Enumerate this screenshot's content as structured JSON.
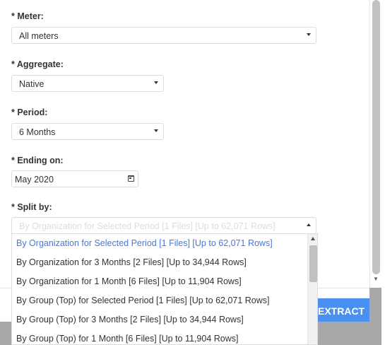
{
  "form": {
    "meter": {
      "label": "* Meter:",
      "value": "All meters"
    },
    "aggregate": {
      "label": "* Aggregate:",
      "value": "Native"
    },
    "period": {
      "label": "* Period:",
      "value": "6 Months"
    },
    "ending_on": {
      "label": "* Ending on:",
      "value": "May 2020"
    },
    "split_by": {
      "label": "* Split by:",
      "value": "By Organization for Selected Period [1 Files] [Up to 62,071 Rows]",
      "options": [
        {
          "label": "By Organization for Selected Period [1 Files] [Up to 62,071 Rows]",
          "selected": true
        },
        {
          "label": "By Organization for 3 Months [2 Files] [Up to 34,944 Rows]",
          "selected": false
        },
        {
          "label": "By Organization for 1 Month [6 Files] [Up to 11,904 Rows]",
          "selected": false
        },
        {
          "label": "By Group (Top) for Selected Period [1 Files] [Up to 62,071 Rows]",
          "selected": false
        },
        {
          "label": "By Group (Top) for 3 Months [2 Files] [Up to 34,944 Rows]",
          "selected": false
        },
        {
          "label": "By Group (Top) for 1 Month [6 Files] [Up to 11,904 Rows]",
          "selected": false
        }
      ]
    }
  },
  "footer": {
    "extract_label": "EXTRACT"
  },
  "icons": {
    "dropdown": "caret-down-icon",
    "calendar": "calendar-icon",
    "scroll_up": "scroll-up-arrow-icon",
    "scroll_down": "scroll-down-arrow-icon"
  },
  "colors": {
    "accent": "#4a90f0",
    "selected_option": "#4a78d4",
    "overlay": "#a8a8a8"
  }
}
